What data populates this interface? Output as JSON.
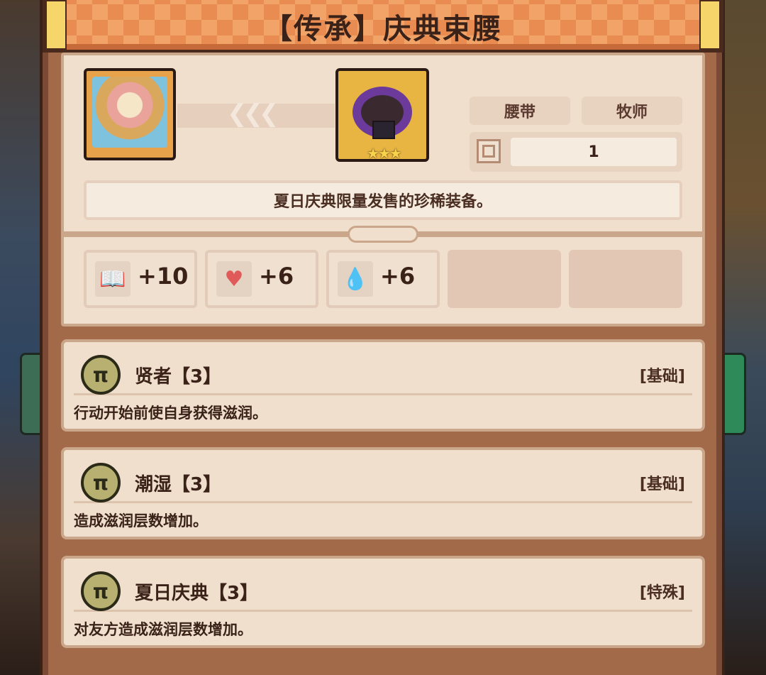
{
  "title": "【传承】庆典束腰",
  "item": {
    "icon": "belt-icon",
    "stars": "★★★",
    "type_label": "腰带",
    "class_label": "牧师",
    "level": "1",
    "description": "夏日庆典限量发售的珍稀装备。"
  },
  "portrait": {
    "icon": "character-portrait"
  },
  "transfer_arrows": "❮❮❮",
  "stats": [
    {
      "icon": "book-icon",
      "glyph": "📖",
      "value": "+10"
    },
    {
      "icon": "heart-icon",
      "glyph": "♥",
      "value": "+6"
    },
    {
      "icon": "water-drop-icon",
      "glyph": "💧",
      "value": "+6"
    }
  ],
  "traits": [
    {
      "badge": "π",
      "name": "贤者【3】",
      "tag": "[基础]",
      "desc": "行动开始前使自身获得滋润。"
    },
    {
      "badge": "π",
      "name": "潮湿【3】",
      "tag": "[基础]",
      "desc": "造成滋润层数增加。"
    },
    {
      "badge": "π",
      "name": "夏日庆典【3】",
      "tag": "[特殊]",
      "desc": "对友方造成滋润层数增加。"
    }
  ],
  "colors": {
    "title_bar": "#e88c52",
    "panel": "#f0dfcc",
    "text": "#3a2218",
    "badge": "#b8b070"
  }
}
